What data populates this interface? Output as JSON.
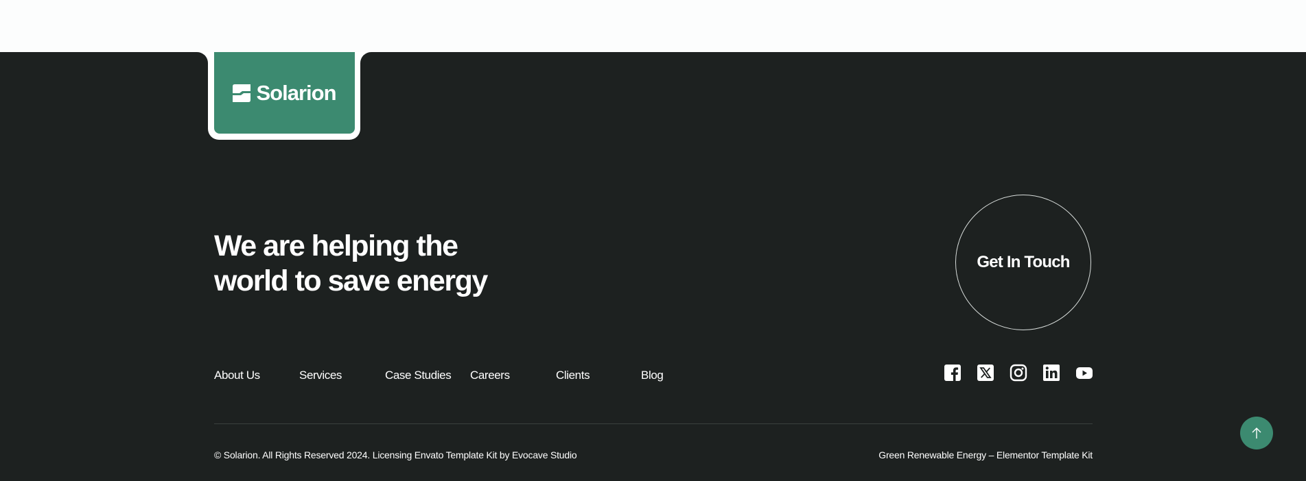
{
  "brand": {
    "name": "Solarion",
    "logo_icon": "solarion-logo-mark",
    "accent_color": "#3c8a70",
    "footer_bg": "#1d2120"
  },
  "headline": {
    "line1": "We are helping the",
    "line2": "world to save energy"
  },
  "cta": {
    "label": "Get In Touch"
  },
  "nav": {
    "items": [
      {
        "label": "About Us"
      },
      {
        "label": "Services"
      },
      {
        "label": "Case Studies"
      },
      {
        "label": "Careers"
      },
      {
        "label": "Clients"
      },
      {
        "label": "Blog"
      }
    ]
  },
  "social": {
    "icons": [
      "facebook-icon",
      "x-twitter-icon",
      "instagram-icon",
      "linkedin-icon",
      "youtube-icon"
    ]
  },
  "footer": {
    "copyright": "© Solarion. All Rights Reserved 2024. Licensing Envato Template Kit by Evocave Studio",
    "tagline": "Green Renewable Energy – Elementor Template Kit"
  },
  "scroll_top": {
    "icon": "arrow-up-icon"
  }
}
